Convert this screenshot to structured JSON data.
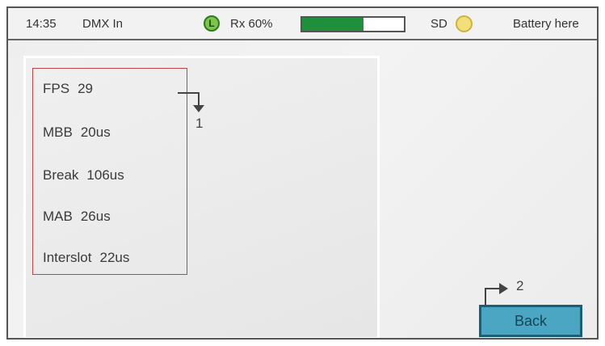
{
  "status_bar": {
    "time": "14:35",
    "mode": "DMX In",
    "indicator_letter": "L",
    "rx_label": "Rx 60%",
    "rx_percent": 60,
    "sd_label": "SD",
    "battery_label": "Battery here"
  },
  "items": [
    {
      "label": "FPS",
      "value": "29"
    },
    {
      "label": "MBB",
      "value": "20us"
    },
    {
      "label": "Break",
      "value": "106us"
    },
    {
      "label": "MAB",
      "value": "26us"
    },
    {
      "label": "Interslot",
      "value": "22us"
    }
  ],
  "callouts": {
    "one": "1",
    "two": "2"
  },
  "back_button": {
    "label": "Back"
  },
  "colors": {
    "rx_fill": "#1f8f3c",
    "indicator_green": "#7ec44a",
    "sd_yellow": "#f3df7a",
    "button_fill": "#4aa6c2",
    "list_border": "#c0444a"
  },
  "icons": {
    "indicator": "l-status-icon",
    "sd_status": "sd-status-icon",
    "callout_arrows": "callout-arrow-icon"
  }
}
